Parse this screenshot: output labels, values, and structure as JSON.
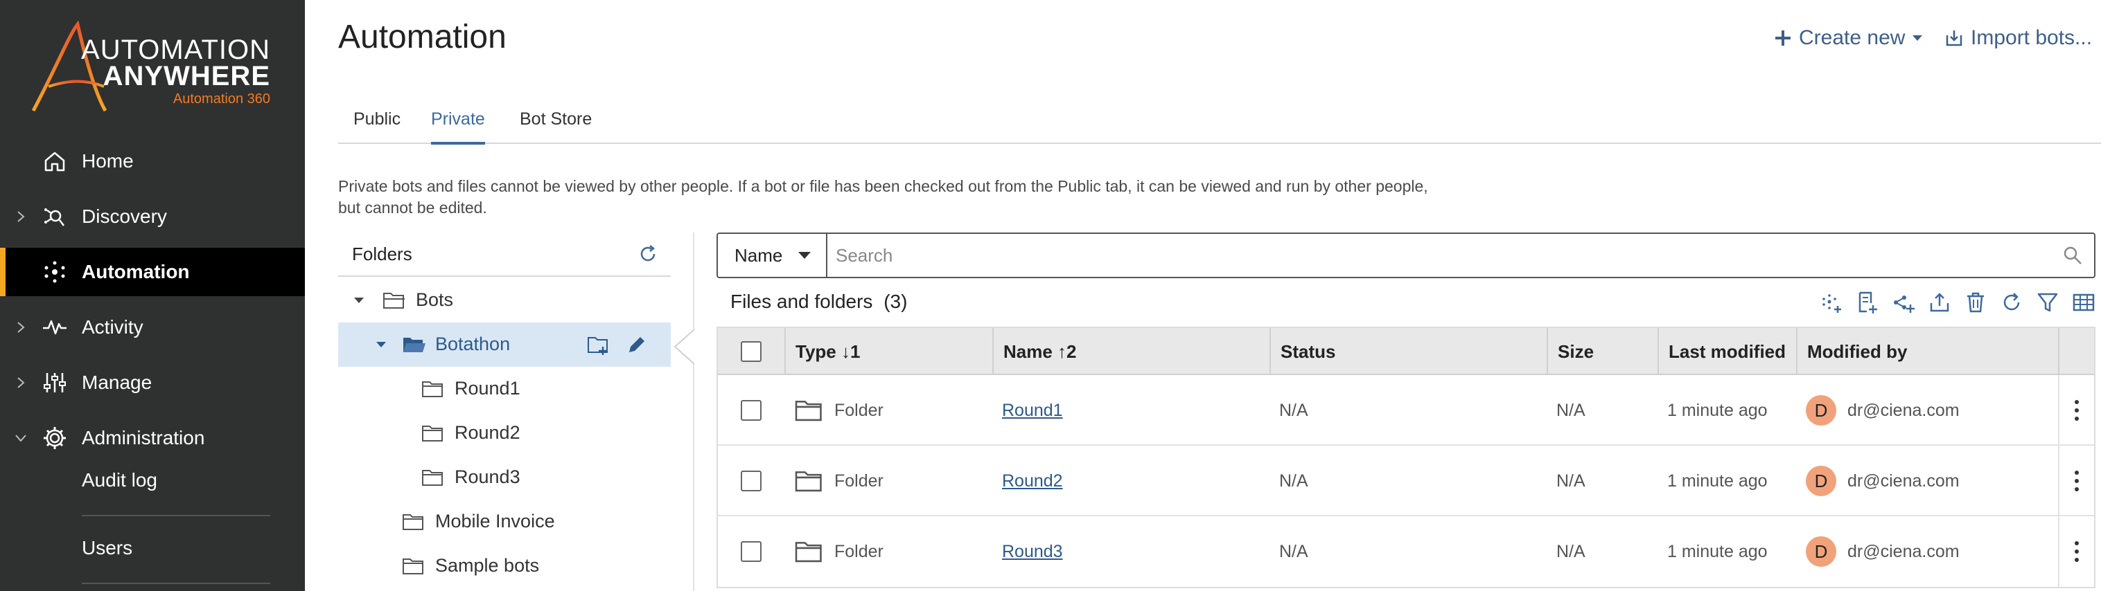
{
  "brand": {
    "line1": "AUTOMATION",
    "line2": "ANYWHERE",
    "line3": "Automation 360",
    "accent": "#f47b20"
  },
  "sidebar": {
    "items": [
      {
        "label": "Home",
        "icon": "home-icon"
      },
      {
        "label": "Discovery",
        "icon": "discovery-icon"
      },
      {
        "label": "Automation",
        "icon": "automation-icon"
      },
      {
        "label": "Activity",
        "icon": "activity-icon"
      },
      {
        "label": "Manage",
        "icon": "manage-icon"
      },
      {
        "label": "Administration",
        "icon": "gear-icon"
      }
    ],
    "sub_items": [
      "Audit log",
      "Users"
    ]
  },
  "header": {
    "title": "Automation",
    "create_new": "Create new",
    "import_bots": "Import bots..."
  },
  "tabs": [
    "Public",
    "Private",
    "Bot Store"
  ],
  "active_tab": "Private",
  "description": "Private bots and files cannot be viewed by other people. If a bot or file has been checked out from the Public tab, it can be viewed and run by other people, but cannot be edited.",
  "folders": {
    "title": "Folders",
    "tree": [
      {
        "label": "Bots",
        "expanded": true
      },
      {
        "label": "Botathon",
        "expanded": true,
        "selected": true
      },
      {
        "label": "Round1"
      },
      {
        "label": "Round2"
      },
      {
        "label": "Round3"
      },
      {
        "label": "Mobile Invoice"
      },
      {
        "label": "Sample bots"
      }
    ]
  },
  "search": {
    "field": "Name",
    "placeholder": "Search"
  },
  "files": {
    "title": "Files and folders",
    "count": "(3)",
    "columns": [
      "Type ↓1",
      "Name ↑2",
      "Status",
      "Size",
      "Last modified",
      "Modified by"
    ],
    "rows": [
      {
        "type": "Folder",
        "name": "Round1",
        "status": "N/A",
        "size": "N/A",
        "modified": "1 minute ago",
        "avatar": "D",
        "by": "dr@ciena.com"
      },
      {
        "type": "Folder",
        "name": "Round2",
        "status": "N/A",
        "size": "N/A",
        "modified": "1 minute ago",
        "avatar": "D",
        "by": "dr@ciena.com"
      },
      {
        "type": "Folder",
        "name": "Round3",
        "status": "N/A",
        "size": "N/A",
        "modified": "1 minute ago",
        "avatar": "D",
        "by": "dr@ciena.com"
      }
    ]
  }
}
